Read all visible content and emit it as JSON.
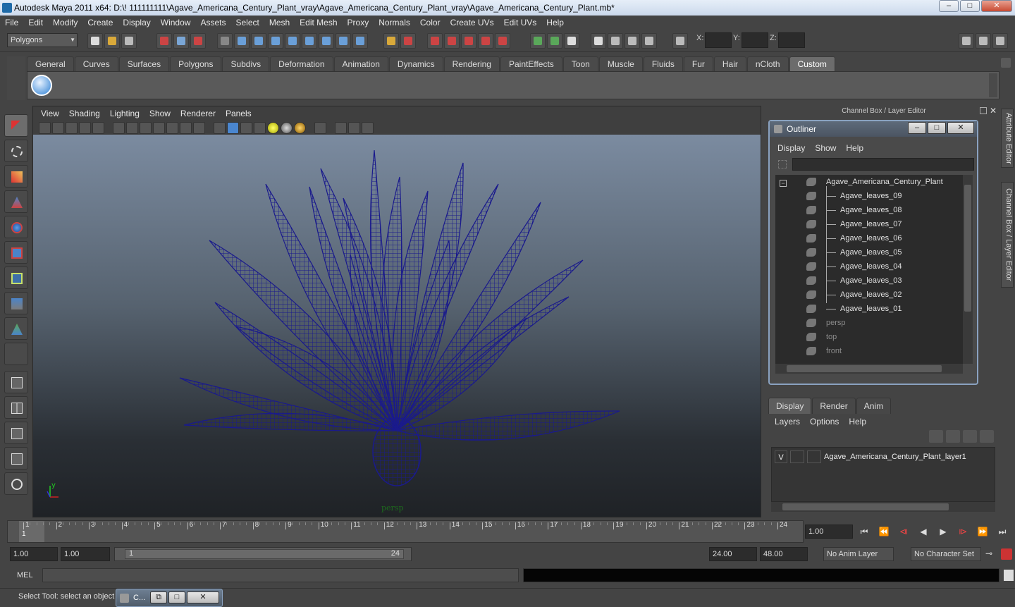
{
  "window": {
    "title": "Autodesk Maya 2011 x64: D:\\! 111111111\\Agave_Americana_Century_Plant_vray\\Agave_Americana_Century_Plant_vray\\Agave_Americana_Century_Plant.mb*",
    "min": "–",
    "max": "□",
    "close": "✕"
  },
  "menubar": [
    "File",
    "Edit",
    "Modify",
    "Create",
    "Display",
    "Window",
    "Assets",
    "Select",
    "Mesh",
    "Edit Mesh",
    "Proxy",
    "Normals",
    "Color",
    "Create UVs",
    "Edit UVs",
    "Help"
  ],
  "statusline": {
    "menuset": "Polygons",
    "x_label": "X:",
    "y_label": "Y:",
    "z_label": "Z:"
  },
  "shelf": {
    "tabs": [
      "General",
      "Curves",
      "Surfaces",
      "Polygons",
      "Subdivs",
      "Deformation",
      "Animation",
      "Dynamics",
      "Rendering",
      "PaintEffects",
      "Toon",
      "Muscle",
      "Fluids",
      "Fur",
      "Hair",
      "nCloth",
      "Custom"
    ],
    "active": "Custom"
  },
  "viewport": {
    "menu": [
      "View",
      "Shading",
      "Lighting",
      "Show",
      "Renderer",
      "Panels"
    ],
    "camera": "persp",
    "wire_color": "#1a1a8c"
  },
  "channelbox": {
    "title": "Channel Box / Layer Editor"
  },
  "outliner": {
    "title": "Outliner",
    "menu": [
      "Display",
      "Show",
      "Help"
    ],
    "expander": "−",
    "root": "Agave_Americana_Century_Plant",
    "children": [
      "Agave_leaves_09",
      "Agave_leaves_08",
      "Agave_leaves_07",
      "Agave_leaves_06",
      "Agave_leaves_05",
      "Agave_leaves_04",
      "Agave_leaves_03",
      "Agave_leaves_02",
      "Agave_leaves_01"
    ],
    "cameras": [
      "persp",
      "top",
      "front"
    ]
  },
  "sidetabs": {
    "attribute_editor": "Attribute Editor",
    "channel_box": "Channel Box / Layer Editor"
  },
  "layers": {
    "tabs": [
      "Display",
      "Render",
      "Anim"
    ],
    "active": "Display",
    "menu": [
      "Layers",
      "Options",
      "Help"
    ],
    "row": {
      "visible": "V",
      "name": "Agave_Americana_Century_Plant_layer1"
    }
  },
  "timeline": {
    "ticks": [
      "1",
      "2",
      "3",
      "4",
      "5",
      "6",
      "7",
      "8",
      "9",
      "10",
      "11",
      "12",
      "13",
      "14",
      "15",
      "16",
      "17",
      "18",
      "19",
      "20",
      "21",
      "22",
      "23",
      "24"
    ],
    "current_frame": "1",
    "current_time": "1.00",
    "playback": [
      "⏮",
      "⏪",
      "⧏",
      "◀",
      "▶",
      "⧐",
      "⏩",
      "⏭"
    ]
  },
  "range": {
    "start": "1.00",
    "start_inner": "1.00",
    "slider_start": "1",
    "slider_end": "24",
    "end_inner": "24.00",
    "end": "48.00",
    "anim_layer": "No Anim Layer",
    "character_set": "No Character Set"
  },
  "cmdline": {
    "label": "MEL"
  },
  "helpline": {
    "text": "Select Tool: select an object",
    "task_label": "C...",
    "task_min": "⧉",
    "task_max": "□",
    "task_close": "✕"
  }
}
